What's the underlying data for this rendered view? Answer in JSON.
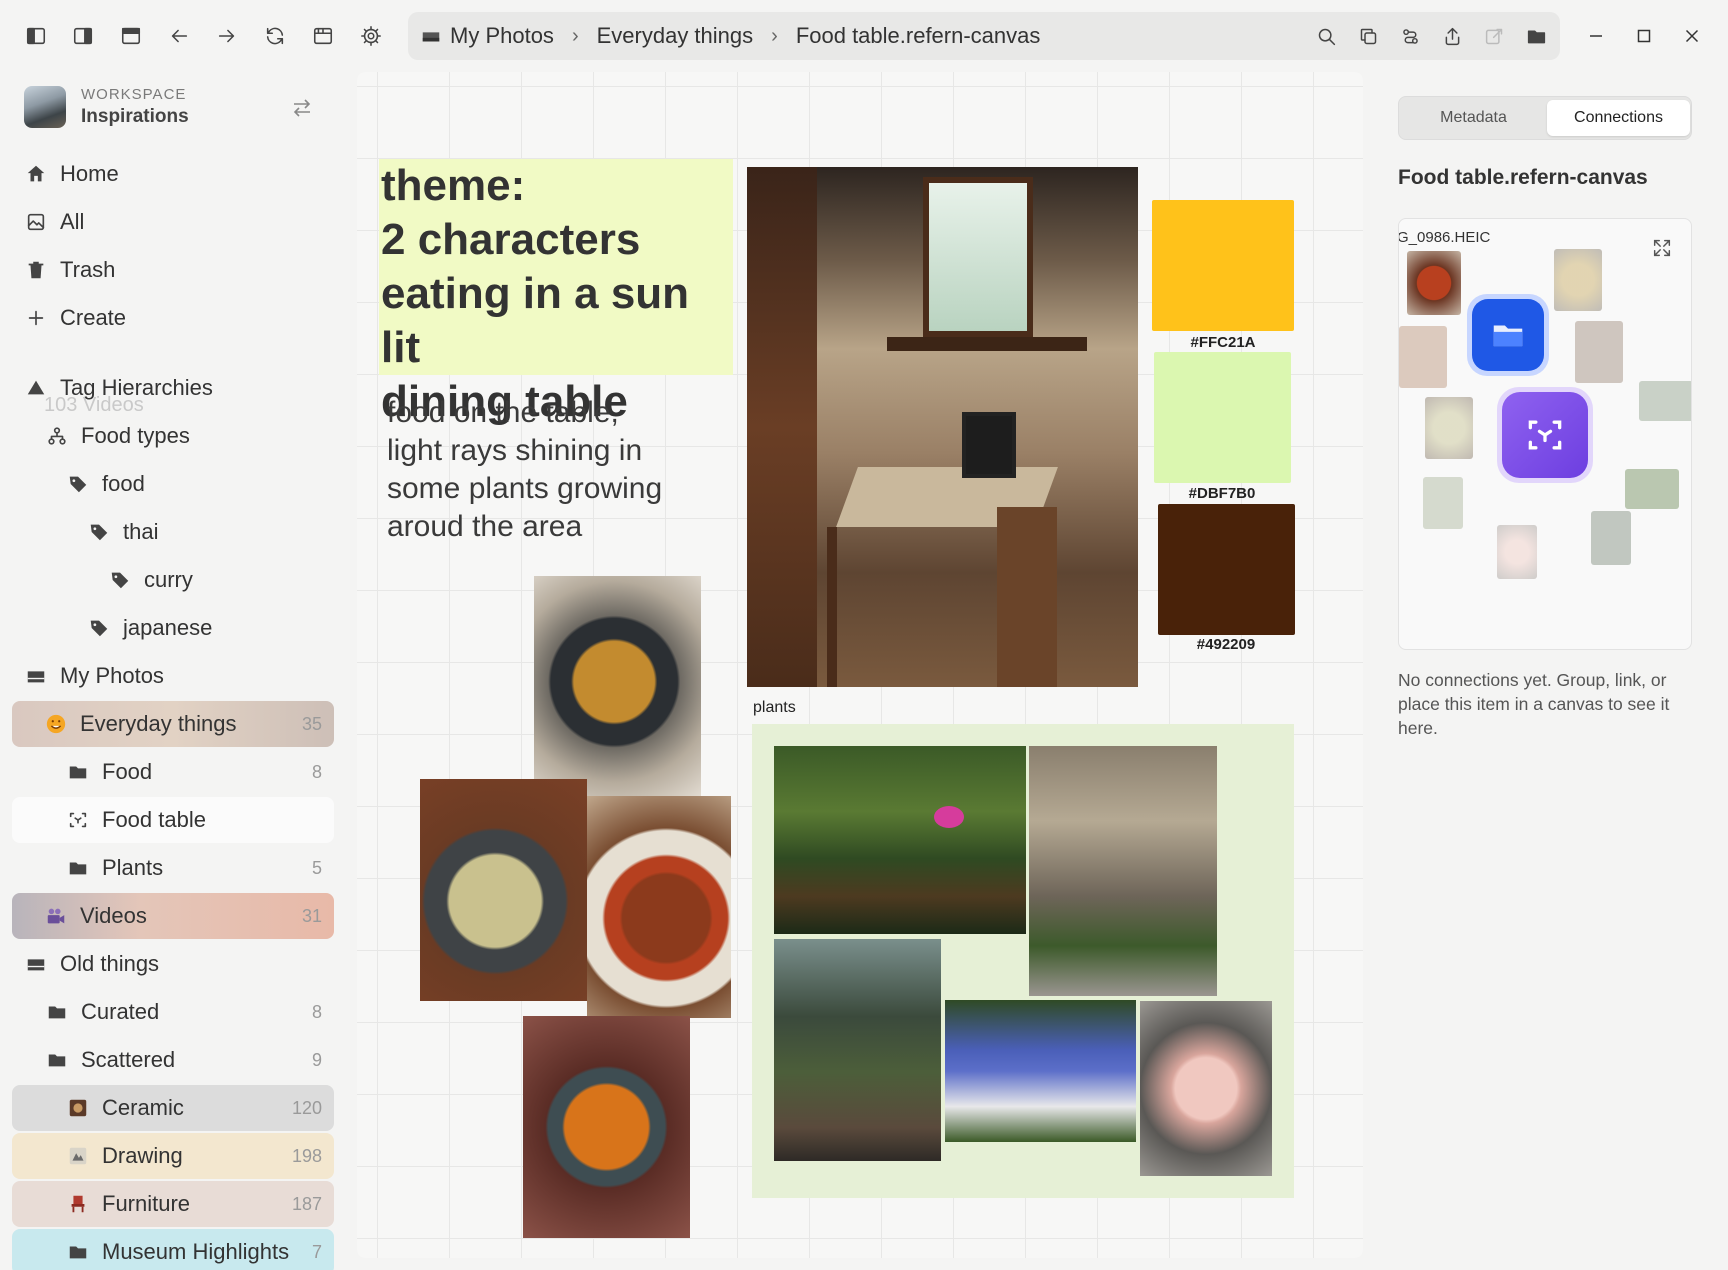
{
  "breadcrumb": {
    "items": [
      "My Photos",
      "Everyday things",
      "Food table.refern-canvas"
    ]
  },
  "workspace": {
    "label": "WORKSPACE",
    "name": "Inspirations"
  },
  "sidebar": {
    "home": "Home",
    "all": "All",
    "trash": "Trash",
    "create": "Create",
    "ghost_row": "103 Videos",
    "tag_hierarchies": "Tag Hierarchies",
    "food_types": "Food types",
    "tags": {
      "food": "food",
      "thai": "thai",
      "curry": "curry",
      "japanese": "japanese"
    },
    "my_photos": "My Photos",
    "everyday_things": {
      "label": "Everyday things",
      "count": "35"
    },
    "food": {
      "label": "Food",
      "count": "8"
    },
    "food_table": {
      "label": "Food table"
    },
    "plants": {
      "label": "Plants",
      "count": "5"
    },
    "videos": {
      "label": "Videos",
      "count": "31"
    },
    "old_things": "Old things",
    "curated": {
      "label": "Curated",
      "count": "8"
    },
    "scattered": {
      "label": "Scattered",
      "count": "9"
    },
    "ceramic": {
      "label": "Ceramic",
      "count": "120"
    },
    "drawing": {
      "label": "Drawing",
      "count": "198"
    },
    "furniture": {
      "label": "Furniture",
      "count": "187"
    },
    "museum": {
      "label": "Museum Highlights",
      "count": "7"
    }
  },
  "canvas": {
    "theme_lines": [
      "theme:",
      "2 characters",
      "eating in a sun lit",
      "dining table"
    ],
    "description_lines": [
      "food on the table,",
      "light rays shining in",
      "some plants growing",
      "aroud the area"
    ],
    "swatches": [
      {
        "hex": "#FFC21A",
        "label": "#FFC21A"
      },
      {
        "hex": "#DBF7B0",
        "label": "#DBF7B0"
      },
      {
        "hex": "#492209",
        "label": "#492209"
      }
    ],
    "plants_label": "plants"
  },
  "right_panel": {
    "tabs": [
      "Metadata",
      "Connections"
    ],
    "active_tab": "Connections",
    "title": "Food table.refern-canvas",
    "graph_file": "G_0986.HEIC",
    "empty_text": "No connections yet. Group, link, or place this item in a canvas to see it here."
  },
  "colors": {
    "accent_blue": "#1f58e6",
    "accent_purple": "#7c4dea",
    "note_yellow": "#f1fac5",
    "plants_group": "#e6f0d6"
  }
}
